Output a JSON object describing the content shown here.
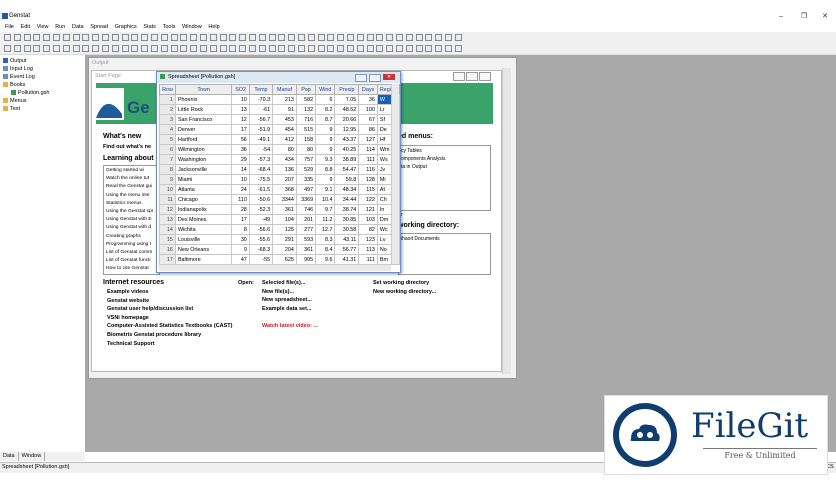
{
  "app": {
    "title": "Genstat"
  },
  "window_controls": {
    "minimize": "‒",
    "restore": "❐",
    "close": "✕"
  },
  "menu": [
    "File",
    "Edit",
    "View",
    "Run",
    "Data",
    "Spread",
    "Graphics",
    "Stats",
    "Tools",
    "Window",
    "Help"
  ],
  "tree": [
    {
      "label": "Output",
      "icon": "output-icon"
    },
    {
      "label": "Input Log",
      "icon": "log-icon"
    },
    {
      "label": "Event Log",
      "icon": "log-icon"
    },
    {
      "label": "Books",
      "icon": "folder-icon"
    },
    {
      "label": "Pollution.gsh",
      "icon": "sheet-icon"
    },
    {
      "label": "Menus",
      "icon": "folder-icon"
    },
    {
      "label": "Text",
      "icon": "folder-icon"
    }
  ],
  "left_tabs": [
    "Data",
    "Window"
  ],
  "output_window": {
    "title": "Output"
  },
  "start_page": {
    "title": "Start Page",
    "logo": "Ge",
    "whats_new": "What's new",
    "find_out": "Find out what's ne",
    "learning_about": "Learning about",
    "learning_items": [
      "Getting started wi",
      "Watch the online tut",
      "Read the Genstat gui",
      "Using the menu inte",
      "Statistics menus",
      "Using the Genstat spr",
      "Using Genstat with E",
      "Using Genstat with d",
      "Creating graphs",
      "Programming using t",
      "List of Genstat comm",
      "List of Genstat functi",
      "How to cite Genstat"
    ],
    "customised_menus": "ed menus:",
    "menu_items": [
      "cy Tables",
      "omponents Analysis",
      "",
      "ta in Output"
    ],
    "working_dir_heading": "working directory:",
    "working_dir_items": [
      "ihaoit Documents"
    ],
    "or_label": "or",
    "internet_resources": "Internet resources",
    "internet_links": [
      "Example videos",
      "Genstat website",
      "Genstat user help/discussion list",
      "VSNi homepage",
      "Computer-Assisted Statistics Textbooks (CAST)",
      "Biometris Genstat procedure library",
      "Technical Support"
    ],
    "open_label": "Open:",
    "open_links": [
      "Selected file(s)...",
      "New file(s)...",
      "New spreadsheet...",
      "Example data set..."
    ],
    "watch_video": "Watch latest video: ...",
    "dir_links": [
      "Set working directory",
      "New working directory..."
    ]
  },
  "spreadsheet": {
    "title": "Spreadsheet [Pollution.gsh]",
    "columns": [
      "Row",
      "Town",
      "SO2",
      "Temp",
      "Manuf",
      "Pop",
      "Wind",
      "Precip",
      "Days",
      "Region"
    ],
    "rows": [
      [
        "1",
        "Phoenix",
        "10",
        "-70.3",
        "213",
        "582",
        "6",
        "7.05",
        "36",
        "W"
      ],
      [
        "2",
        "Little Rock",
        "13",
        "-61",
        "91",
        "132",
        "8.2",
        "48.52",
        "100",
        "Lr"
      ],
      [
        "3",
        "San Francisco",
        "12",
        "-56.7",
        "453",
        "716",
        "8.7",
        "20.66",
        "67",
        "Sf"
      ],
      [
        "4",
        "Denver",
        "17",
        "-51.9",
        "454",
        "515",
        "9",
        "12.95",
        "86",
        "De"
      ],
      [
        "5",
        "Hartford",
        "56",
        "-49.1",
        "412",
        "158",
        "9",
        "43.37",
        "127",
        "Hf"
      ],
      [
        "6",
        "Wilmington",
        "36",
        "-54",
        "80",
        "80",
        "9",
        "40.25",
        "114",
        "Wm"
      ],
      [
        "7",
        "Washington",
        "29",
        "-57.3",
        "434",
        "757",
        "9.3",
        "38.89",
        "111",
        "Ws"
      ],
      [
        "8",
        "Jacksonville",
        "14",
        "-68.4",
        "136",
        "529",
        "8.8",
        "54.47",
        "116",
        "Jv"
      ],
      [
        "9",
        "Miami",
        "10",
        "-75.5",
        "207",
        "335",
        "9",
        "59.8",
        "128",
        "Mi"
      ],
      [
        "10",
        "Atlanta",
        "24",
        "-61.5",
        "368",
        "497",
        "9.1",
        "48.34",
        "115",
        "At"
      ],
      [
        "11",
        "Chicago",
        "110",
        "-50.6",
        "3344",
        "3369",
        "10.4",
        "34.44",
        "122",
        "Ch"
      ],
      [
        "12",
        "Indianapolis",
        "28",
        "-52.3",
        "361",
        "746",
        "9.7",
        "38.74",
        "121",
        "In"
      ],
      [
        "13",
        "Des Moines",
        "17",
        "-49",
        "104",
        "201",
        "11.2",
        "30.85",
        "103",
        "Dm"
      ],
      [
        "14",
        "Wichita",
        "8",
        "-56.6",
        "125",
        "277",
        "12.7",
        "30.58",
        "82",
        "Wc"
      ],
      [
        "15",
        "Louisville",
        "30",
        "-55.6",
        "291",
        "593",
        "8.3",
        "43.11",
        "123",
        "Lv"
      ],
      [
        "16",
        "New Orleans",
        "9",
        "-68.3",
        "204",
        "361",
        "8.4",
        "56.77",
        "113",
        "No"
      ],
      [
        "17",
        "Baltimore",
        "47",
        "-55",
        "625",
        "905",
        "9.6",
        "41.31",
        "111",
        "Bm"
      ]
    ]
  },
  "status": {
    "left": "Spreadsheet [Pollution.gsh]",
    "right": "CS"
  },
  "watermark": {
    "name": "FileGit",
    "tagline": "Free & Unlimited",
    "accent": "#0f3d6e"
  }
}
